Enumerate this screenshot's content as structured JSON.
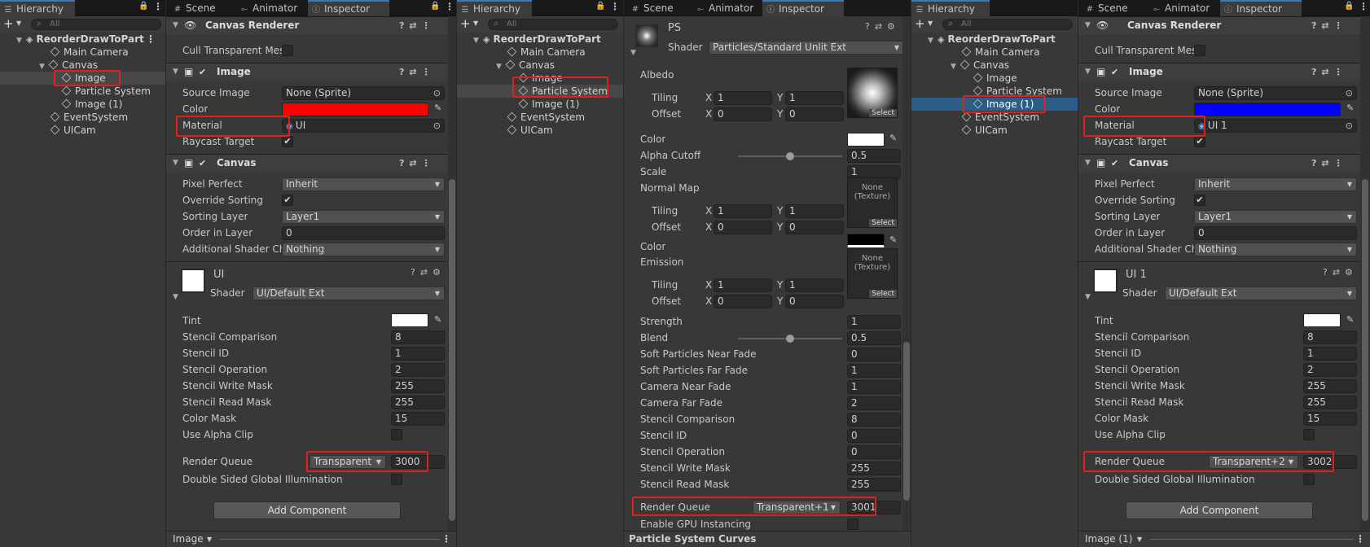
{
  "tabs": {
    "hierarchy": "Hierarchy",
    "scene": "Scene",
    "animator": "Animator",
    "inspector": "Inspector"
  },
  "search_placeholder": "All",
  "hierarchy": {
    "root": "ReorderDrawToPart",
    "main_camera": "Main Camera",
    "canvas": "Canvas",
    "image": "Image",
    "particle_system": "Particle System",
    "image1": "Image (1)",
    "event_system": "EventSystem",
    "uicam": "UICam"
  },
  "insp1": {
    "canvas_renderer": "Canvas Renderer",
    "cull": "Cull Transparent Mes",
    "image_header": "Image",
    "source_image_label": "Source Image",
    "source_image_value": "None (Sprite)",
    "color_label": "Color",
    "color_value": "#ff0000",
    "material_label": "Material",
    "material_value": "UI",
    "raycast_label": "Raycast Target",
    "canvas_header": "Canvas",
    "pixel_perfect_label": "Pixel Perfect",
    "pixel_perfect_value": "Inherit",
    "override_label": "Override Sorting",
    "sorting_layer_label": "Sorting Layer",
    "sorting_layer_value": "Layer1",
    "order_label": "Order in Layer",
    "order_value": "0",
    "shader_ch_label": "Additional Shader Cha",
    "shader_ch_value": "Nothing",
    "mat_name": "UI",
    "shader_label": "Shader",
    "shader_value": "UI/Default Ext",
    "tint_label": "Tint",
    "stencil_comp_label": "Stencil Comparison",
    "stencil_comp": "8",
    "stencil_id_label": "Stencil ID",
    "stencil_id": "1",
    "stencil_op_label": "Stencil Operation",
    "stencil_op": "2",
    "stencil_write_label": "Stencil Write Mask",
    "stencil_write": "255",
    "stencil_read_label": "Stencil Read Mask",
    "stencil_read": "255",
    "color_mask_label": "Color Mask",
    "color_mask": "15",
    "alpha_clip_label": "Use Alpha Clip",
    "render_queue_label": "Render Queue",
    "render_queue_mode": "Transparent",
    "render_queue_value": "3000",
    "dsgi_label": "Double Sided Global Illumination",
    "add_component": "Add Component",
    "bottom": "Image"
  },
  "insp2": {
    "mat_name": "PS",
    "shader_label": "Shader",
    "shader_value": "Particles/Standard Unlit Ext",
    "albedo": "Albedo",
    "tiling": "Tiling",
    "offset": "Offset",
    "x": "X",
    "y": "Y",
    "one": "1",
    "zero": "0",
    "select": "Select",
    "color": "Color",
    "alpha_cutoff": "Alpha Cutoff",
    "alpha_cutoff_value": "0.5",
    "scale": "Scale",
    "scale_value": "1",
    "normal_map": "Normal Map",
    "none_texture": "None (Texture)",
    "emission": "Emission",
    "strength": "Strength",
    "strength_value": "1",
    "blend": "Blend",
    "blend_value": "0.5",
    "soft_near": "Soft Particles Near Fade",
    "soft_near_value": "0",
    "soft_far": "Soft Particles Far Fade",
    "soft_far_value": "1",
    "cam_near": "Camera Near Fade",
    "cam_near_value": "1",
    "cam_far": "Camera Far Fade",
    "cam_far_value": "2",
    "stencil_comp": "Stencil Comparison",
    "stencil_comp_value": "8",
    "stencil_id": "Stencil ID",
    "stencil_id_value": "0",
    "stencil_op": "Stencil Operation",
    "stencil_op_value": "0",
    "stencil_write": "Stencil Write Mask",
    "stencil_write_value": "255",
    "stencil_read": "Stencil Read Mask",
    "stencil_read_value": "255",
    "render_queue_label": "Render Queue",
    "render_queue_mode": "Transparent+1",
    "render_queue_value": "3001",
    "gpu_instancing": "Enable GPU Instancing",
    "bottom": "Particle System Curves"
  },
  "insp3": {
    "material_value": "UI 1",
    "color_value": "#0000ff",
    "mat_name": "UI 1",
    "render_queue_mode": "Transparent+2",
    "render_queue_value": "3002",
    "bottom": "Image (1)"
  },
  "colors": {
    "accent_blue": "#2c5d87",
    "highlight_red": "#e0201f"
  }
}
